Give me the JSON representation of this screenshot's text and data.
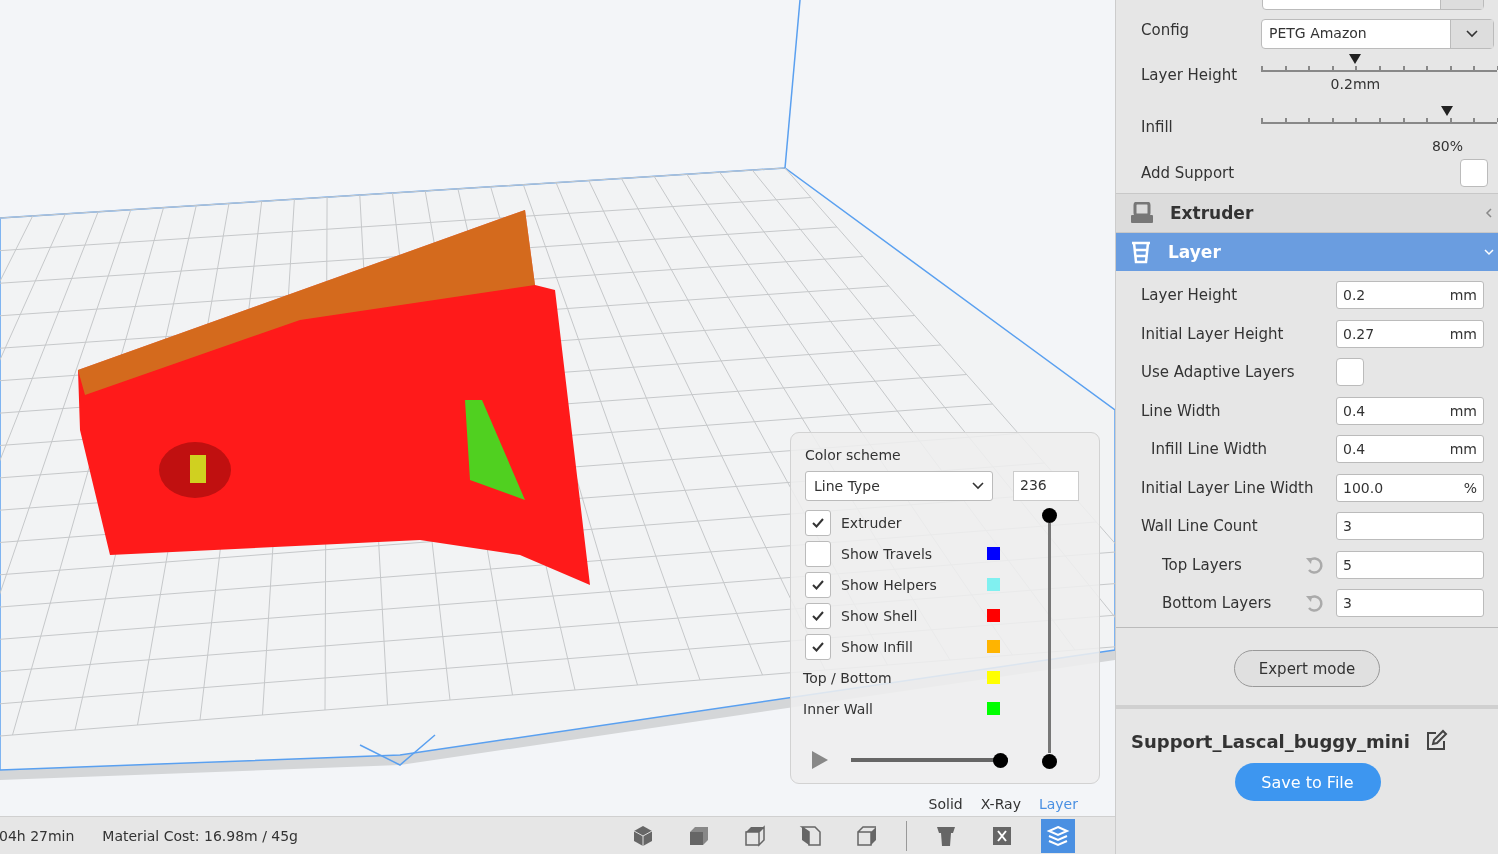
{
  "viewport": {
    "color_scheme": {
      "label": "Color scheme",
      "select": "Line Type",
      "layer_number": "236",
      "options": [
        {
          "kind": "check",
          "label": "Extruder",
          "checked": true
        },
        {
          "kind": "check",
          "label": "Show Travels",
          "checked": false,
          "color": "#0000ff"
        },
        {
          "kind": "check",
          "label": "Show Helpers",
          "checked": true,
          "color": "#80f0f0"
        },
        {
          "kind": "check",
          "label": "Show Shell",
          "checked": true,
          "color": "#ff0000"
        },
        {
          "kind": "check",
          "label": "Show Infill",
          "checked": true,
          "color": "#ffb400"
        },
        {
          "kind": "legend",
          "label": "Top / Bottom",
          "color": "#ffff00"
        },
        {
          "kind": "legend",
          "label": "Inner Wall",
          "color": "#00ff00"
        }
      ],
      "layer_slider": {
        "level": 1
      },
      "path_slider": {
        "level": 1
      }
    },
    "view_modes": [
      {
        "label": "Solid",
        "selected": false
      },
      {
        "label": "X-Ray",
        "selected": false
      },
      {
        "label": "Layer",
        "selected": true
      }
    ]
  },
  "status_bar": {
    "print_time": "04h 27min",
    "material_cost": "Material Cost: 16.98m / 45g",
    "toolbar": [
      {
        "kind": "iso",
        "selected": false
      },
      {
        "kind": "front",
        "selected": false
      },
      {
        "kind": "top",
        "selected": false
      },
      {
        "kind": "left",
        "selected": false
      },
      {
        "kind": "right",
        "selected": false
      },
      {
        "kind": "support",
        "selected": false
      },
      {
        "kind": "xray",
        "selected": false
      },
      {
        "kind": "layers",
        "selected": true
      }
    ]
  },
  "sidebar": {
    "config": {
      "label": "Config",
      "value": "PETG Amazon"
    },
    "layer_height": {
      "label": "Layer Height",
      "reading": "0.2mm",
      "level": 0.4
    },
    "infill": {
      "label": "Infill",
      "reading": "80%",
      "level": 0.79
    },
    "add_support": {
      "label": "Add Support",
      "checked": false
    },
    "sections": [
      {
        "kind": "extruder",
        "title": "Extruder",
        "expanded": false
      },
      {
        "kind": "layer",
        "title": "Layer",
        "expanded": true
      }
    ],
    "settings": [
      {
        "kind": "number",
        "label": "Layer Height",
        "value": "0.2",
        "unit": "mm"
      },
      {
        "kind": "number",
        "label": "Initial Layer Height",
        "value": "0.27",
        "unit": "mm"
      },
      {
        "kind": "check",
        "label": "Use Adaptive Layers",
        "checked": false
      },
      {
        "kind": "number",
        "label": "Line Width",
        "value": "0.4",
        "unit": "mm",
        "children": [
          {
            "kind": "number",
            "label": "Infill Line Width",
            "value": "0.4",
            "unit": "mm"
          }
        ]
      },
      {
        "kind": "number",
        "label": "Initial Layer Line Width",
        "value": "100.0",
        "unit": "%"
      },
      {
        "kind": "number",
        "label": "Wall Line Count",
        "value": "3",
        "children": [
          {
            "kind": "number",
            "label": "Top Layers",
            "value": "5",
            "resettable": true
          },
          {
            "kind": "number",
            "label": "Bottom Layers",
            "value": "3",
            "resettable": true
          }
        ]
      }
    ],
    "expert_button": "Expert mode",
    "file_name": "Support_Lascal_buggy_mini",
    "save_button": "Save to File"
  }
}
